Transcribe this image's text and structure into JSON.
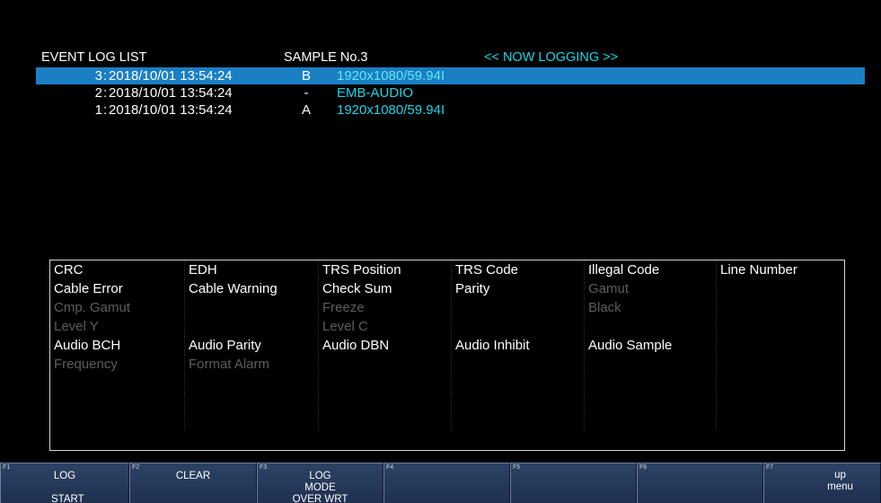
{
  "header": {
    "title": "EVENT LOG LIST",
    "sample": "SAMPLE No.3",
    "status": "<< NOW LOGGING >>"
  },
  "log_entries": [
    {
      "num": "3",
      "timestamp": "2018/10/01 13:54:24",
      "channel": "B",
      "detail": "1920x1080/59.94I",
      "selected": true
    },
    {
      "num": "2",
      "timestamp": "2018/10/01 13:54:24",
      "channel": "-",
      "detail": "EMB-AUDIO",
      "selected": false
    },
    {
      "num": "1",
      "timestamp": "2018/10/01 13:54:24",
      "channel": "A",
      "detail": "1920x1080/59.94I",
      "selected": false
    }
  ],
  "error_table": {
    "rows": [
      [
        {
          "label": "CRC",
          "enabled": true
        },
        {
          "label": "EDH",
          "enabled": true
        },
        {
          "label": "TRS Position",
          "enabled": true
        },
        {
          "label": "TRS Code",
          "enabled": true
        },
        {
          "label": "Illegal Code",
          "enabled": true
        },
        {
          "label": "Line Number",
          "enabled": true
        }
      ],
      [
        {
          "label": "Cable Error",
          "enabled": true
        },
        {
          "label": "Cable Warning",
          "enabled": true
        },
        {
          "label": "Check Sum",
          "enabled": true
        },
        {
          "label": "Parity",
          "enabled": true
        },
        {
          "label": "Gamut",
          "enabled": false
        },
        {
          "label": "",
          "enabled": false
        }
      ],
      [
        {
          "label": "Cmp. Gamut",
          "enabled": false
        },
        {
          "label": "",
          "enabled": false
        },
        {
          "label": "Freeze",
          "enabled": false
        },
        {
          "label": "",
          "enabled": false
        },
        {
          "label": "Black",
          "enabled": false
        },
        {
          "label": "",
          "enabled": false
        }
      ],
      [
        {
          "label": "Level Y",
          "enabled": false
        },
        {
          "label": "",
          "enabled": false
        },
        {
          "label": "Level C",
          "enabled": false
        },
        {
          "label": "",
          "enabled": false
        },
        {
          "label": "",
          "enabled": false
        },
        {
          "label": "",
          "enabled": false
        }
      ],
      [
        {
          "label": "Audio BCH",
          "enabled": true
        },
        {
          "label": "Audio Parity",
          "enabled": true
        },
        {
          "label": "Audio DBN",
          "enabled": true
        },
        {
          "label": "Audio Inhibit",
          "enabled": true
        },
        {
          "label": "Audio Sample",
          "enabled": true
        },
        {
          "label": "",
          "enabled": false
        }
      ],
      [
        {
          "label": "Frequency",
          "enabled": false
        },
        {
          "label": "Format Alarm",
          "enabled": false
        },
        {
          "label": "",
          "enabled": false
        },
        {
          "label": "",
          "enabled": false
        },
        {
          "label": "",
          "enabled": false
        },
        {
          "label": "",
          "enabled": false
        }
      ],
      [
        {
          "label": "",
          "enabled": false
        },
        {
          "label": "",
          "enabled": false
        },
        {
          "label": "",
          "enabled": false
        },
        {
          "label": "",
          "enabled": false
        },
        {
          "label": "",
          "enabled": false
        },
        {
          "label": "",
          "enabled": false
        }
      ],
      [
        {
          "label": "",
          "enabled": false
        },
        {
          "label": "",
          "enabled": false
        },
        {
          "label": "",
          "enabled": false
        },
        {
          "label": "",
          "enabled": false
        },
        {
          "label": "",
          "enabled": false
        },
        {
          "label": "",
          "enabled": false
        }
      ],
      [
        {
          "label": "",
          "enabled": false
        },
        {
          "label": "",
          "enabled": false
        },
        {
          "label": "",
          "enabled": false
        },
        {
          "label": "",
          "enabled": false
        },
        {
          "label": "",
          "enabled": false
        },
        {
          "label": "",
          "enabled": false
        }
      ]
    ]
  },
  "function_keys": [
    {
      "key": "F1",
      "line1": "LOG",
      "line2": "START"
    },
    {
      "key": "F2",
      "line1": "CLEAR",
      "line2": ""
    },
    {
      "key": "F3",
      "line1": "LOG MODE",
      "line2": "OVER WRT"
    },
    {
      "key": "F4",
      "line1": "",
      "line2": ""
    },
    {
      "key": "F5",
      "line1": "",
      "line2": ""
    },
    {
      "key": "F6",
      "line1": "",
      "line2": ""
    },
    {
      "key": "F7",
      "line1": "up menu",
      "line2": ""
    }
  ],
  "colors": {
    "background": "#000000",
    "selection": "#1b7fc4",
    "accent_cyan": "#18d6e8",
    "disabled_text": "#5d5d5d",
    "fkey_fill": "#273a5c"
  }
}
